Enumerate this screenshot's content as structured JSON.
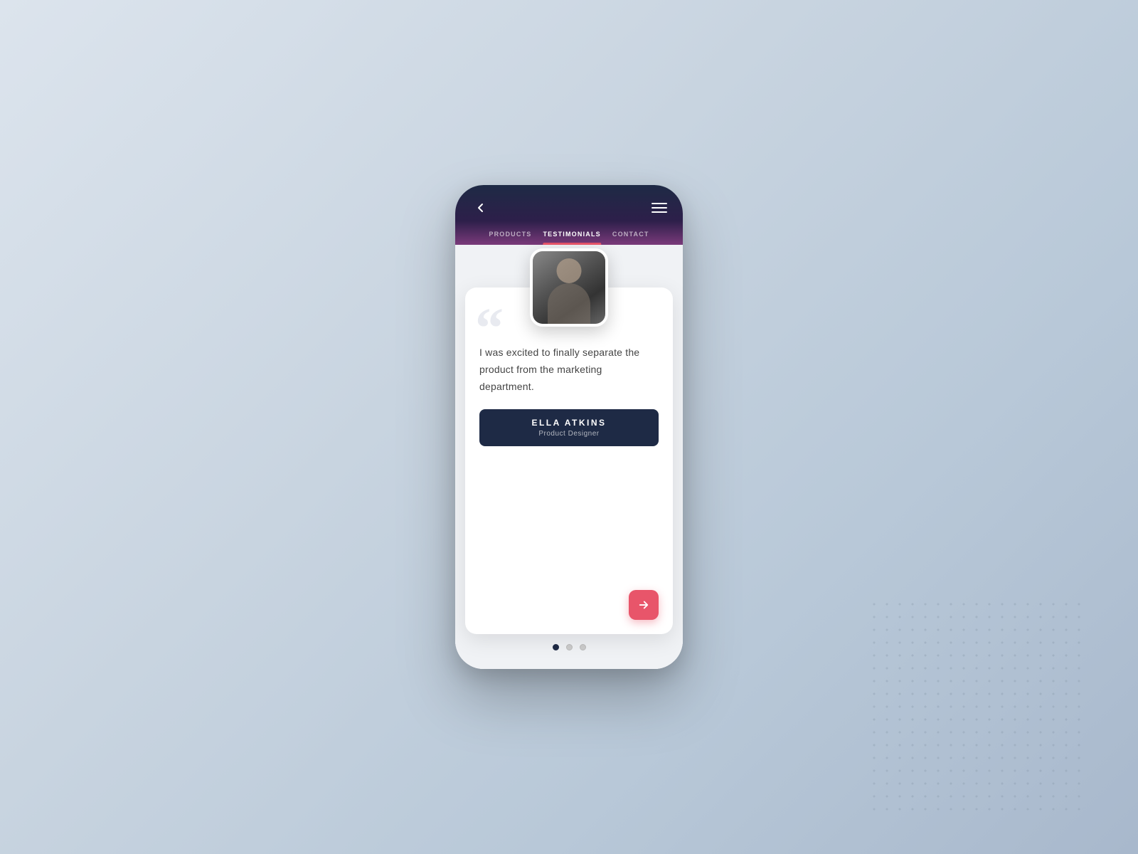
{
  "background": {
    "color_start": "#dce4ed",
    "color_end": "#a8b8cc"
  },
  "phone": {
    "header": {
      "back_icon": "←",
      "menu_icon": "≡"
    },
    "nav": {
      "tabs": [
        {
          "id": "products",
          "label": "PRODUCTS",
          "active": false
        },
        {
          "id": "testimonials",
          "label": "TESTIMONIALS",
          "active": true
        },
        {
          "id": "contact",
          "label": "CONTACT",
          "active": false
        }
      ]
    },
    "testimonial": {
      "quote_symbol": "“",
      "quote_text": "I was excited to finally separate the product from the marketing department.",
      "name": "ELLA ATKINS",
      "title": "Product Designer"
    },
    "next_button_label": "→",
    "dots": [
      {
        "active": true
      },
      {
        "active": false
      },
      {
        "active": false
      }
    ]
  }
}
